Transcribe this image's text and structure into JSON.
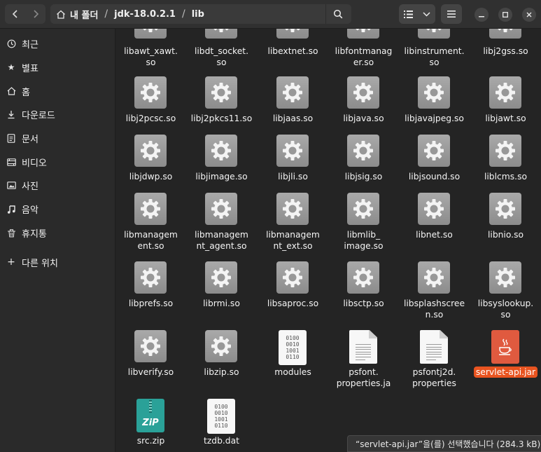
{
  "nav": {
    "back_icon": "chevron-left-icon",
    "forward_icon": "chevron-right-icon"
  },
  "breadcrumb": {
    "home": "내 폴더",
    "folder": "jdk-18.0.2.1",
    "current": "lib"
  },
  "sidebar": {
    "items": [
      {
        "label": "최근",
        "icon": "clock-icon"
      },
      {
        "label": "별표",
        "icon": "star-icon"
      },
      {
        "label": "홈",
        "icon": "home-icon"
      },
      {
        "label": "다운로드",
        "icon": "download-icon"
      },
      {
        "label": "문서",
        "icon": "document-icon"
      },
      {
        "label": "비디오",
        "icon": "video-icon"
      },
      {
        "label": "사진",
        "icon": "picture-icon"
      },
      {
        "label": "음악",
        "icon": "music-icon"
      },
      {
        "label": "휴지통",
        "icon": "trash-icon"
      }
    ],
    "other": {
      "label": "다른 위치",
      "icon": "plus-icon"
    }
  },
  "files": {
    "row0": [
      {
        "name": "libawt_xawt.\nso",
        "type": "library"
      },
      {
        "name": "libdt_socket.\nso",
        "type": "library"
      },
      {
        "name": "libextnet.so",
        "type": "library"
      },
      {
        "name": "libfontmanag\ner.so",
        "type": "library"
      },
      {
        "name": "libinstrument.\nso",
        "type": "library"
      },
      {
        "name": "libj2gss.so",
        "type": "library"
      }
    ],
    "row1": [
      {
        "name": "libj2pcsc.so",
        "type": "library"
      },
      {
        "name": "libj2pkcs11.so",
        "type": "library"
      },
      {
        "name": "libjaas.so",
        "type": "library"
      },
      {
        "name": "libjava.so",
        "type": "library"
      },
      {
        "name": "libjavajpeg.so",
        "type": "library"
      },
      {
        "name": "libjawt.so",
        "type": "library"
      }
    ],
    "row2": [
      {
        "name": "libjdwp.so",
        "type": "library"
      },
      {
        "name": "libjimage.so",
        "type": "library"
      },
      {
        "name": "libjli.so",
        "type": "library"
      },
      {
        "name": "libjsig.so",
        "type": "library"
      },
      {
        "name": "libjsound.so",
        "type": "library"
      },
      {
        "name": "liblcms.so",
        "type": "library"
      }
    ],
    "row3": [
      {
        "name": "libmanagem\nent.so",
        "type": "library"
      },
      {
        "name": "libmanagem\nnt_agent.so",
        "type": "library"
      },
      {
        "name": "libmanagem\nnt_ext.so",
        "type": "library"
      },
      {
        "name": "libmlib_\nimage.so",
        "type": "library"
      },
      {
        "name": "libnet.so",
        "type": "library"
      },
      {
        "name": "libnio.so",
        "type": "library"
      }
    ],
    "row4": [
      {
        "name": "libprefs.so",
        "type": "library"
      },
      {
        "name": "librmi.so",
        "type": "library"
      },
      {
        "name": "libsaproc.so",
        "type": "library"
      },
      {
        "name": "libsctp.so",
        "type": "library"
      },
      {
        "name": "libsplashscree\nn.so",
        "type": "library"
      },
      {
        "name": "libsyslookup.\nso",
        "type": "library"
      }
    ],
    "row5": [
      {
        "name": "libverify.so",
        "type": "library"
      },
      {
        "name": "libzip.so",
        "type": "library"
      },
      {
        "name": "modules",
        "type": "binary"
      },
      {
        "name": "psfont.\nproperties.ja",
        "type": "text"
      },
      {
        "name": "psfontj2d.\nproperties",
        "type": "text"
      },
      {
        "name": "servlet-api.jar",
        "type": "jar",
        "selected": true
      }
    ],
    "row6": [
      {
        "name": "src.zip",
        "type": "zip"
      },
      {
        "name": "tzdb.dat",
        "type": "binary"
      }
    ]
  },
  "binary_glyph": "0100\n0010\n1001\n0110",
  "zip_glyph": "ZiP",
  "status": "“servlet-api.jar”을(를) 선택했습니다  (284.3 kB)",
  "colors": {
    "selection": "#e95420",
    "background": "#242424",
    "sidebar": "#2a2a2a",
    "zip": "#2aa198",
    "jar": "#e05a3f"
  }
}
